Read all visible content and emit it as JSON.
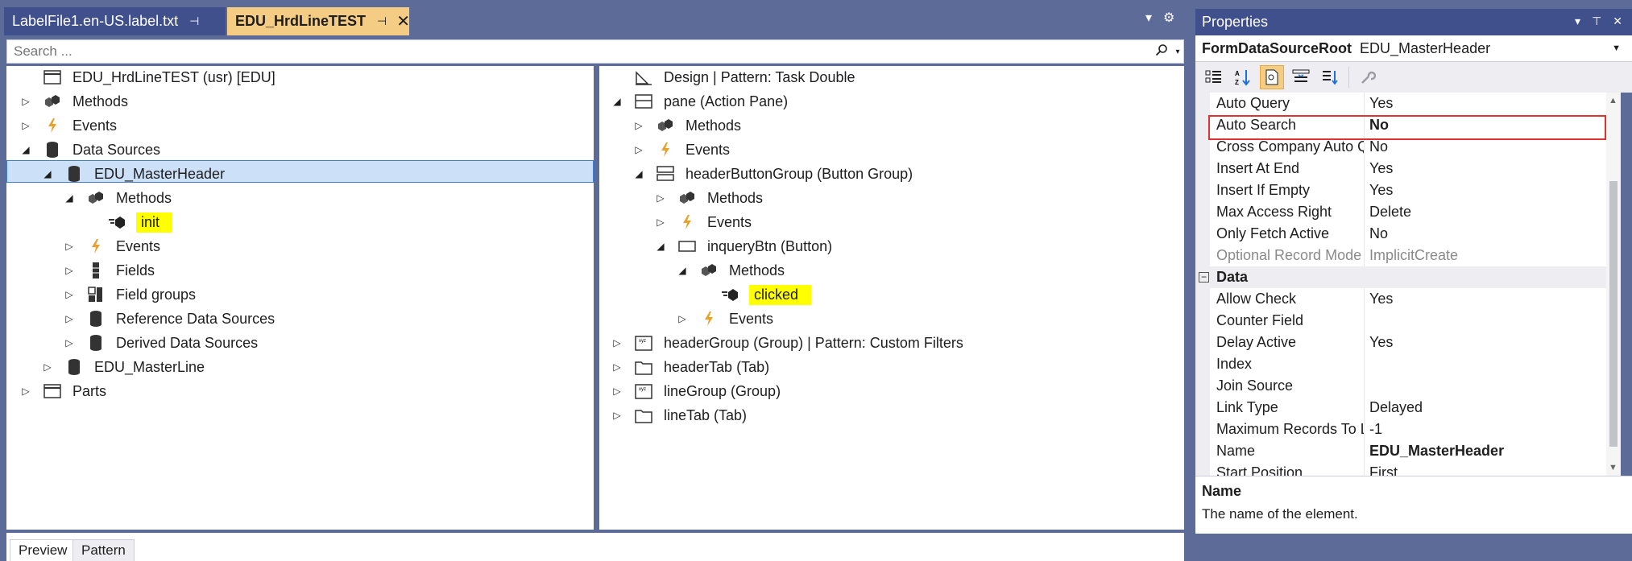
{
  "tabs": {
    "inactive": "LabelFile1.en-US.label.txt",
    "active": "EDU_HrdLineTEST",
    "pin": "⊣",
    "close": "✕"
  },
  "search": {
    "placeholder": "Search ..."
  },
  "left_tree": [
    {
      "label": "EDU_HrdLineTEST (usr) [EDU]",
      "icon": "form-icon",
      "toggle": "",
      "level": 0
    },
    {
      "label": "Methods",
      "icon": "methods-icon",
      "toggle": "▷",
      "level": 0
    },
    {
      "label": "Events",
      "icon": "event-icon",
      "toggle": "▷",
      "level": 0
    },
    {
      "label": "Data Sources",
      "icon": "datasource-icon",
      "toggle": "◢",
      "level": 0
    },
    {
      "label": "EDU_MasterHeader",
      "icon": "datasource-icon",
      "toggle": "◢",
      "level": 1,
      "selected": true
    },
    {
      "label": "Methods",
      "icon": "methods-icon",
      "toggle": "◢",
      "level": 2
    },
    {
      "label": "init",
      "icon": "method-icon",
      "toggle": "",
      "level": 3,
      "highlight": true
    },
    {
      "label": "Events",
      "icon": "event-icon",
      "toggle": "▷",
      "level": 2
    },
    {
      "label": "Fields",
      "icon": "field-icon",
      "toggle": "▷",
      "level": 2
    },
    {
      "label": "Field groups",
      "icon": "fieldgroup-icon",
      "toggle": "▷",
      "level": 2
    },
    {
      "label": "Reference Data Sources",
      "icon": "datasource-icon",
      "toggle": "▷",
      "level": 2
    },
    {
      "label": "Derived Data Sources",
      "icon": "datasource-icon",
      "toggle": "▷",
      "level": 2
    },
    {
      "label": "EDU_MasterLine",
      "icon": "datasource-icon",
      "toggle": "▷",
      "level": 1
    },
    {
      "label": "Parts",
      "icon": "form-icon",
      "toggle": "▷",
      "level": 0
    }
  ],
  "right_tree": [
    {
      "label": "Design | Pattern: Task Double",
      "icon": "design-icon",
      "toggle": "",
      "level": 0
    },
    {
      "label": "pane (Action Pane)",
      "icon": "actionpane-icon",
      "toggle": "◢",
      "level": 0
    },
    {
      "label": "Methods",
      "icon": "methods-icon",
      "toggle": "▷",
      "level": 1
    },
    {
      "label": "Events",
      "icon": "event-icon",
      "toggle": "▷",
      "level": 1
    },
    {
      "label": "headerButtonGroup (Button Group)",
      "icon": "buttongroup-icon",
      "toggle": "◢",
      "level": 1
    },
    {
      "label": "Methods",
      "icon": "methods-icon",
      "toggle": "▷",
      "level": 2
    },
    {
      "label": "Events",
      "icon": "event-icon",
      "toggle": "▷",
      "level": 2
    },
    {
      "label": "inqueryBtn (Button)",
      "icon": "button-icon",
      "toggle": "◢",
      "level": 2
    },
    {
      "label": "Methods",
      "icon": "methods-icon",
      "toggle": "◢",
      "level": 3
    },
    {
      "label": "clicked",
      "icon": "method-icon",
      "toggle": "",
      "level": 4,
      "highlight": true
    },
    {
      "label": "Events",
      "icon": "event-icon",
      "toggle": "▷",
      "level": 3
    },
    {
      "label": "headerGroup (Group) | Pattern: Custom Filters",
      "icon": "group-icon",
      "toggle": "▷",
      "level": 0
    },
    {
      "label": "headerTab (Tab)",
      "icon": "tab-icon",
      "toggle": "▷",
      "level": 0
    },
    {
      "label": "lineGroup (Group)",
      "icon": "group-icon",
      "toggle": "▷",
      "level": 0
    },
    {
      "label": "lineTab (Tab)",
      "icon": "tab-icon",
      "toggle": "▷",
      "level": 0
    }
  ],
  "bottom_tabs": {
    "preview": "Preview",
    "pattern": "Pattern"
  },
  "properties": {
    "title": "Properties",
    "object_type": "FormDataSourceRoot",
    "object_name": "EDU_MasterHeader",
    "rows": [
      {
        "name": "Auto Query",
        "value": "Yes"
      },
      {
        "name": "Auto Search",
        "value": "No",
        "bold": true,
        "boxed": true
      },
      {
        "name": "Cross Company Auto Query",
        "value": "No"
      },
      {
        "name": "Insert At End",
        "value": "Yes"
      },
      {
        "name": "Insert If Empty",
        "value": "Yes"
      },
      {
        "name": "Max Access Right",
        "value": "Delete"
      },
      {
        "name": "Only Fetch Active",
        "value": "No"
      },
      {
        "name": "Optional Record Mode",
        "value": "ImplicitCreate",
        "dim": true
      },
      {
        "name": "Data",
        "value": "",
        "category": true
      },
      {
        "name": "Allow Check",
        "value": "Yes"
      },
      {
        "name": "Counter Field",
        "value": ""
      },
      {
        "name": "Delay Active",
        "value": "Yes"
      },
      {
        "name": "Index",
        "value": ""
      },
      {
        "name": "Join Source",
        "value": ""
      },
      {
        "name": "Link Type",
        "value": "Delayed"
      },
      {
        "name": "Maximum Records To Load",
        "value": "-1"
      },
      {
        "name": "Name",
        "value": "EDU_MasterHeader",
        "bold": true
      },
      {
        "name": "Start Position",
        "value": "First"
      }
    ],
    "description_title": "Name",
    "description_text": "The name of the element.",
    "collapse_symbol": "−"
  },
  "colors": {
    "chrome": "#5d6b99",
    "active_tab": "#f5cc84",
    "highlight": "#ffff00",
    "selection": "#cce0f7",
    "red_box": "#e0332f"
  }
}
